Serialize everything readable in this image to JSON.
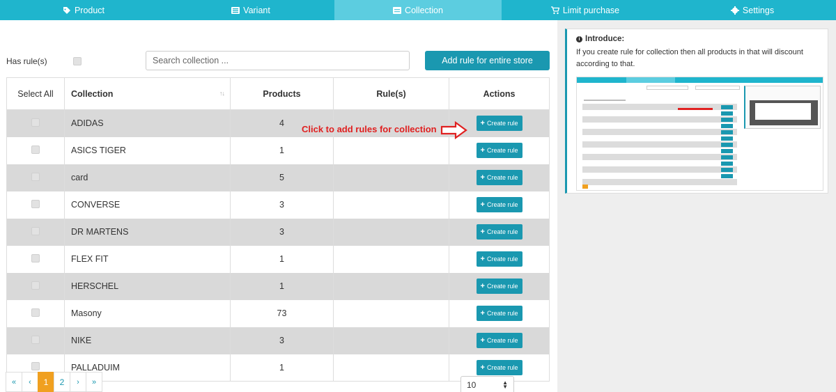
{
  "nav": {
    "tabs": [
      {
        "label": "Product",
        "icon": "tag-icon"
      },
      {
        "label": "Variant",
        "icon": "list-icon"
      },
      {
        "label": "Collection",
        "icon": "collection-icon",
        "active": true
      },
      {
        "label": "Limit purchase",
        "icon": "cart-icon"
      },
      {
        "label": "Settings",
        "icon": "gear-icon"
      }
    ]
  },
  "filter": {
    "has_rule_label": "Has rule(s)",
    "search_placeholder": "Search collection ...",
    "add_store_label": "Add rule for entire store"
  },
  "table": {
    "headers": {
      "select_all": "Select All",
      "collection": "Collection",
      "products": "Products",
      "rules": "Rule(s)",
      "actions": "Actions"
    },
    "create_label": "Create rule",
    "rows": [
      {
        "name": "ADIDAS",
        "products": "4"
      },
      {
        "name": "ASICS TIGER",
        "products": "1"
      },
      {
        "name": "card",
        "products": "5"
      },
      {
        "name": "CONVERSE",
        "products": "3"
      },
      {
        "name": "DR MARTENS",
        "products": "3"
      },
      {
        "name": "FLEX FIT",
        "products": "1"
      },
      {
        "name": "HERSCHEL",
        "products": "1"
      },
      {
        "name": "Masony",
        "products": "73"
      },
      {
        "name": "NIKE",
        "products": "3"
      },
      {
        "name": "PALLADUIM",
        "products": "1"
      }
    ]
  },
  "annotation": {
    "text": "Click to add rules for collection",
    "color": "#e02020"
  },
  "pagination": {
    "first": "«",
    "prev": "‹",
    "pages": [
      "1",
      "2"
    ],
    "current_page": "1",
    "next": "›",
    "last": "»",
    "page_size": "10"
  },
  "introduce": {
    "title": "Introduce:",
    "text": "If you create rule for collection then all products in that will discount according to that."
  },
  "colors": {
    "nav": "#1fb5cd",
    "nav_active": "#5ccde0",
    "button": "#1a98b0",
    "row_alt": "#d9d9d9",
    "page_active": "#f0a020"
  }
}
